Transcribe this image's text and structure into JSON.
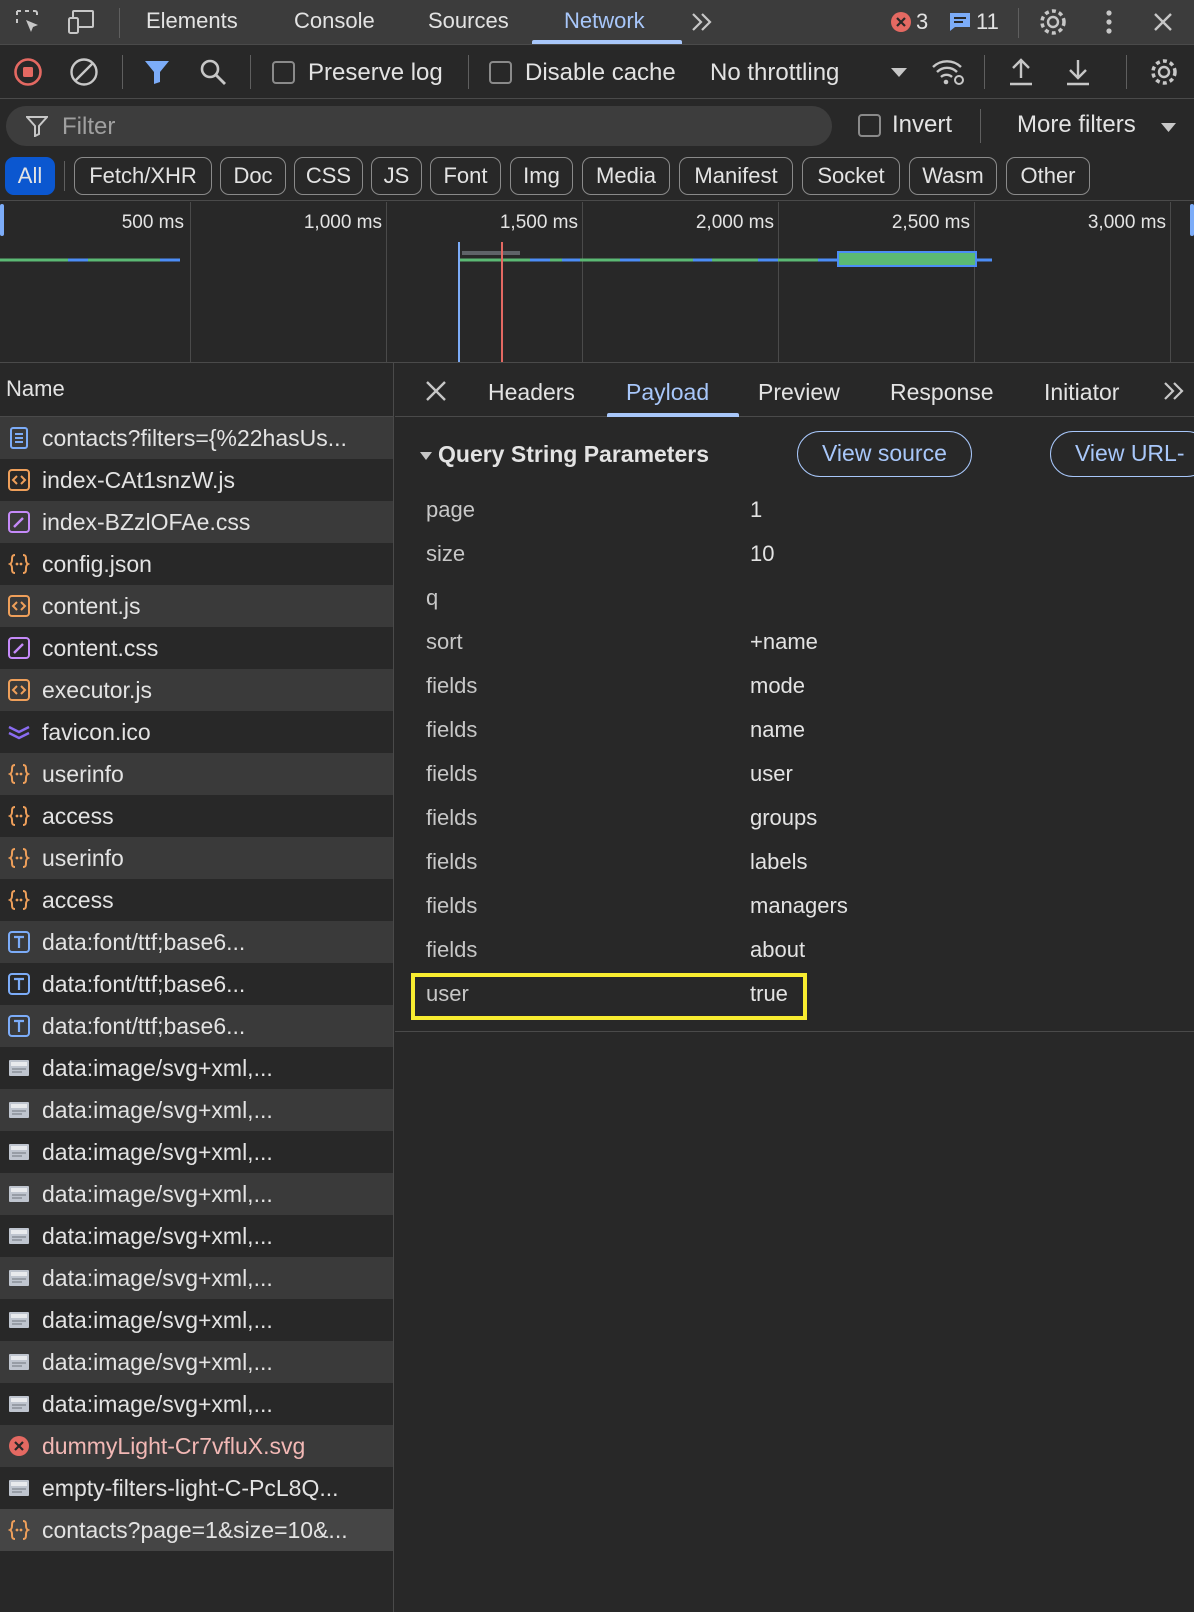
{
  "topbar": {
    "tabs": [
      "Elements",
      "Console",
      "Sources",
      "Network"
    ],
    "active_tab": "Network",
    "error_count": "3",
    "message_count": "11"
  },
  "toolbar": {
    "preserve_log": "Preserve log",
    "disable_cache": "Disable cache",
    "throttling": "No throttling"
  },
  "filter": {
    "placeholder": "Filter",
    "invert": "Invert",
    "more_filters": "More filters"
  },
  "chips": [
    "All",
    "Fetch/XHR",
    "Doc",
    "CSS",
    "JS",
    "Font",
    "Img",
    "Media",
    "Manifest",
    "Socket",
    "Wasm",
    "Other"
  ],
  "overview": {
    "ticks": [
      "500 ms",
      "1,000 ms",
      "1,500 ms",
      "2,000 ms",
      "2,500 ms",
      "3,000 ms"
    ]
  },
  "request_list": {
    "header": "Name",
    "rows": [
      {
        "name": "contacts?filters={%22hasUs...",
        "type": "doc"
      },
      {
        "name": "index-CAt1snzW.js",
        "type": "js"
      },
      {
        "name": "index-BZzlOFAe.css",
        "type": "css"
      },
      {
        "name": "config.json",
        "type": "json"
      },
      {
        "name": "content.js",
        "type": "js"
      },
      {
        "name": "content.css",
        "type": "css"
      },
      {
        "name": "executor.js",
        "type": "js"
      },
      {
        "name": "favicon.ico",
        "type": "ico"
      },
      {
        "name": "userinfo",
        "type": "json"
      },
      {
        "name": "access",
        "type": "json"
      },
      {
        "name": "userinfo",
        "type": "json"
      },
      {
        "name": "access",
        "type": "json"
      },
      {
        "name": "data:font/ttf;base6...",
        "type": "font"
      },
      {
        "name": "data:font/ttf;base6...",
        "type": "font"
      },
      {
        "name": "data:font/ttf;base6...",
        "type": "font"
      },
      {
        "name": "data:image/svg+xml,...",
        "type": "img"
      },
      {
        "name": "data:image/svg+xml,...",
        "type": "img"
      },
      {
        "name": "data:image/svg+xml,...",
        "type": "img"
      },
      {
        "name": "data:image/svg+xml,...",
        "type": "img"
      },
      {
        "name": "data:image/svg+xml,...",
        "type": "img"
      },
      {
        "name": "data:image/svg+xml,...",
        "type": "img"
      },
      {
        "name": "data:image/svg+xml,...",
        "type": "img"
      },
      {
        "name": "data:image/svg+xml,...",
        "type": "img"
      },
      {
        "name": "data:image/svg+xml,...",
        "type": "img"
      },
      {
        "name": "dummyLight-Cr7vfluX.svg",
        "type": "error"
      },
      {
        "name": "empty-filters-light-C-PcL8Q...",
        "type": "img"
      },
      {
        "name": "contacts?page=1&size=10&...",
        "type": "json"
      }
    ]
  },
  "detail": {
    "tabs": [
      "Headers",
      "Payload",
      "Preview",
      "Response",
      "Initiator"
    ],
    "active_tab": "Payload",
    "section_title": "Query String Parameters",
    "view_source": "View source",
    "view_url": "View URL-",
    "params": [
      {
        "key": "page",
        "value": "1"
      },
      {
        "key": "size",
        "value": "10"
      },
      {
        "key": "q",
        "value": ""
      },
      {
        "key": "sort",
        "value": "+name"
      },
      {
        "key": "fields",
        "value": "mode"
      },
      {
        "key": "fields",
        "value": "name"
      },
      {
        "key": "fields",
        "value": "user"
      },
      {
        "key": "fields",
        "value": "groups"
      },
      {
        "key": "fields",
        "value": "labels"
      },
      {
        "key": "fields",
        "value": "managers"
      },
      {
        "key": "fields",
        "value": "about"
      },
      {
        "key": "user",
        "value": "true"
      }
    ]
  },
  "colors": {
    "accent": "#a8c7fa",
    "active_chip": "#0b57d0",
    "highlight": "#f8ec30",
    "error": "#f2b8b5"
  }
}
